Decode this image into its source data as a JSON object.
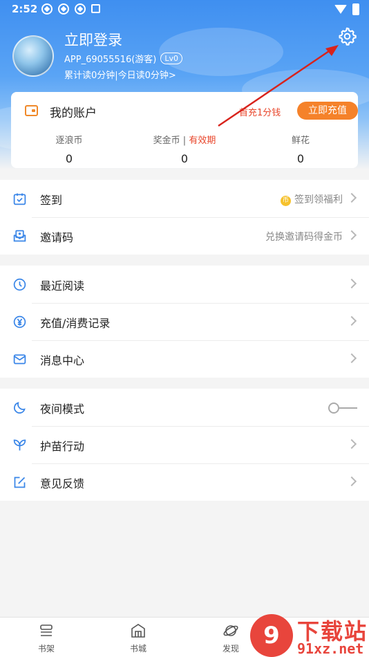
{
  "status_bar": {
    "time": "2:52"
  },
  "profile": {
    "login_title": "立即登录",
    "user_id": "APP_69055516(游客)",
    "level": "Lv0",
    "read_stats": "累计读0分钟|今日读0分钟>"
  },
  "account": {
    "title": "我的账户",
    "promo": "首充1分钱",
    "recharge_label": "立即充值",
    "stats": [
      {
        "label": "逐浪币",
        "value": "0"
      },
      {
        "label": "奖金币",
        "label_suffix": "有效期",
        "value": "0"
      },
      {
        "label": "鲜花",
        "value": "0"
      }
    ]
  },
  "menu": {
    "group1": [
      {
        "label": "签到",
        "extra": "签到领福利",
        "coin": "币"
      },
      {
        "label": "邀请码",
        "extra": "兑换邀请码得金币"
      }
    ],
    "group2": [
      {
        "label": "最近阅读"
      },
      {
        "label": "充值/消费记录"
      },
      {
        "label": "消息中心"
      }
    ],
    "group3": [
      {
        "label": "夜间模式",
        "toggle": "off"
      },
      {
        "label": "护苗行动"
      },
      {
        "label": "意见反馈"
      }
    ]
  },
  "tabbar": {
    "tabs": [
      {
        "label": "书架"
      },
      {
        "label": "书城"
      },
      {
        "label": "发现"
      }
    ]
  },
  "watermark": {
    "logo": "9",
    "title": "下载站",
    "domain": "91xz.net"
  },
  "colors": {
    "accent_orange": "#f5822a",
    "promo_red": "#e8452a",
    "icon_blue": "#3a86e8"
  }
}
